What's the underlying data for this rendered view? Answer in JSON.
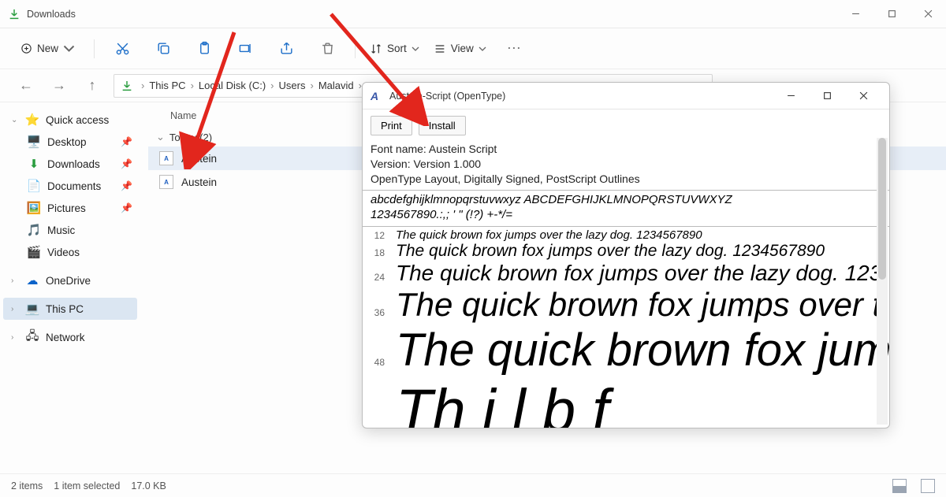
{
  "window": {
    "title": "Downloads"
  },
  "toolbar": {
    "new": "New",
    "sort": "Sort",
    "view": "View"
  },
  "breadcrumb": [
    "This PC",
    "Local Disk (C:)",
    "Users",
    "Malavid"
  ],
  "columns": {
    "name": "Name"
  },
  "group": {
    "today": "Today (2)"
  },
  "files": [
    {
      "name": "Austein"
    },
    {
      "name": "Austein"
    }
  ],
  "sidebar": {
    "quick_access": "Quick access",
    "desktop": "Desktop",
    "downloads": "Downloads",
    "documents": "Documents",
    "pictures": "Pictures",
    "music": "Music",
    "videos": "Videos",
    "onedrive": "OneDrive",
    "this_pc": "This PC",
    "network": "Network"
  },
  "status": {
    "count": "2 items",
    "selected": "1 item selected",
    "size": "17.0 KB"
  },
  "fontwin": {
    "title": "Austein-Script (OpenType)",
    "print": "Print",
    "install": "Install",
    "meta1": "Font name: Austein Script",
    "meta2": "Version: Version 1.000",
    "meta3": "OpenType Layout, Digitally Signed, PostScript Outlines",
    "sample1": "abcdefghijklmnopqrstuvwxyz ABCDEFGHIJKLMNOPQRSTUVWXYZ",
    "sample2": "1234567890.:,; ' \" (!?) +-*/=",
    "lines": [
      {
        "size": "12",
        "text": "The quick brown fox jumps over the lazy dog. 1234567890"
      },
      {
        "size": "18",
        "text": "The quick brown fox jumps over the lazy dog. 1234567890"
      },
      {
        "size": "24",
        "text": "The quick brown fox jumps over the lazy dog. 123"
      },
      {
        "size": "36",
        "text": "The quick brown fox jumps over t"
      },
      {
        "size": "48",
        "text": "The quick brown fox jump"
      },
      {
        "size": "",
        "text": "Th i l b f"
      }
    ]
  }
}
